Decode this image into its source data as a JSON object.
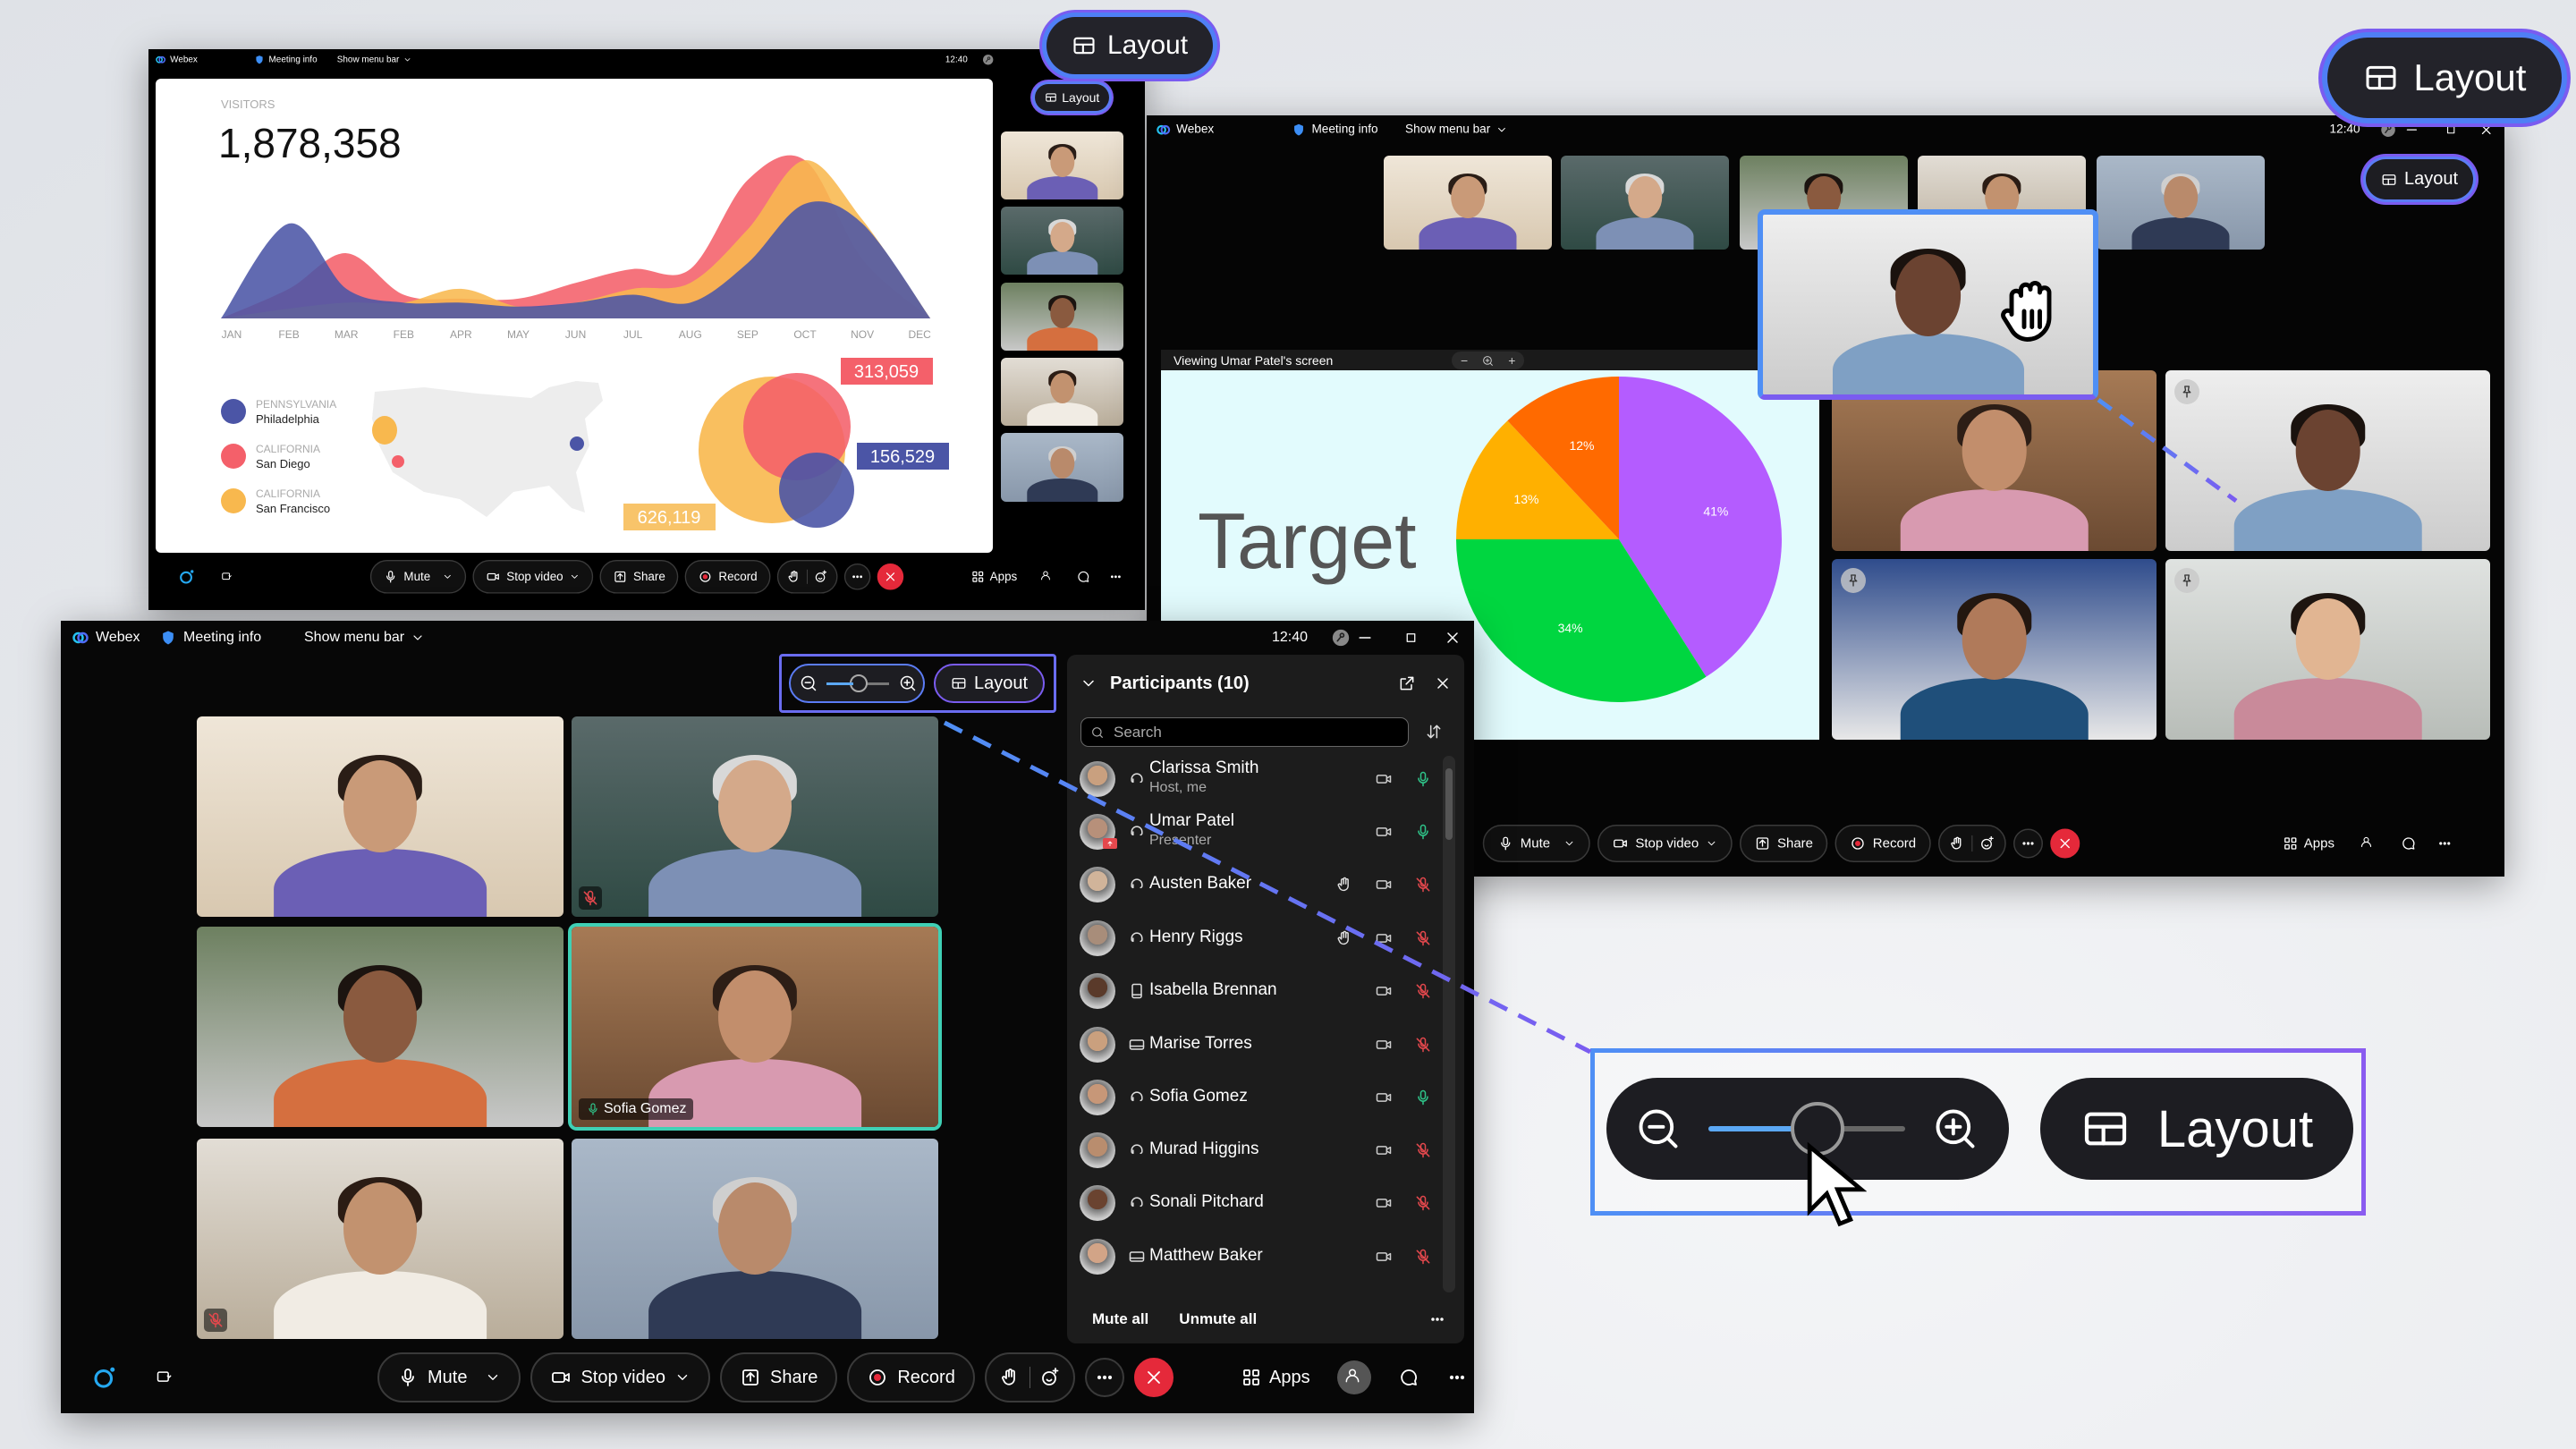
{
  "titlebar": {
    "app": "Webex",
    "meeting_info": "Meeting info",
    "show_menu_bar": "Show menu bar",
    "time": "12:40"
  },
  "toolbar": {
    "mute": "Mute",
    "stop_video": "Stop video",
    "share": "Share",
    "record": "Record",
    "apps": "Apps"
  },
  "layout_label": "Layout",
  "slide": {
    "visitors_label": "VISITORS",
    "visitors_value": "1,878,358",
    "legend": [
      {
        "state": "PENNSYLVANIA",
        "city": "Philadelphia",
        "color": "#4b55a6"
      },
      {
        "state": "CALIFORNIA",
        "city": "San Diego",
        "color": "#f4606a"
      },
      {
        "state": "CALIFORNIA",
        "city": "San Francisco",
        "color": "#f8b84e"
      }
    ],
    "bubble_labels": {
      "red": "313,059",
      "blue": "156,529",
      "yellow": "626,119"
    }
  },
  "chart_data": [
    {
      "type": "area",
      "categories": [
        "JAN",
        "FEB",
        "MAR",
        "FEB",
        "APR",
        "MAY",
        "JUN",
        "JUL",
        "AUG",
        "SEP",
        "OCT",
        "NOV",
        "DEC"
      ],
      "series": [
        {
          "color": "#f4606a",
          "values": [
            0,
            15,
            33,
            12,
            10,
            10,
            18,
            25,
            25,
            70,
            80,
            30,
            0
          ]
        },
        {
          "color": "#f8b84e",
          "values": [
            0,
            5,
            8,
            8,
            15,
            6,
            8,
            15,
            18,
            45,
            80,
            50,
            0
          ]
        },
        {
          "color": "#4b55a6",
          "values": [
            0,
            48,
            15,
            8,
            8,
            6,
            8,
            12,
            8,
            28,
            58,
            48,
            0
          ]
        }
      ],
      "grid": false
    },
    {
      "type": "pie",
      "title": "Target",
      "slices": [
        {
          "label": "41%",
          "value": 41,
          "color": "#b45cff"
        },
        {
          "label": "34%",
          "value": 34,
          "color": "#00d640"
        },
        {
          "label": "13%",
          "value": 13,
          "color": "#ffb000"
        },
        {
          "label": "12%",
          "value": 12,
          "color": "#ff6a00"
        }
      ]
    }
  ],
  "share_banner": "Viewing Umar Patel's screen",
  "tiles": {
    "sofia_label": "Sofia Gomez"
  },
  "participants": {
    "title": "Participants (10)",
    "search_placeholder": "Search",
    "mute_all": "Mute all",
    "unmute_all": "Unmute all",
    "list": [
      {
        "name": "Clarissa Smith",
        "sub": "Host, me",
        "device": "headset",
        "hand": false,
        "mic": "on"
      },
      {
        "name": "Umar Patel",
        "sub": "Presenter",
        "device": "headset",
        "hand": false,
        "mic": "on",
        "sharing": true
      },
      {
        "name": "Austen Baker",
        "sub": "",
        "device": "headset",
        "hand": true,
        "mic": "muted"
      },
      {
        "name": "Henry Riggs",
        "sub": "",
        "device": "headset",
        "hand": true,
        "mic": "muted"
      },
      {
        "name": "Isabella Brennan",
        "sub": "",
        "device": "tablet",
        "hand": false,
        "mic": "muted"
      },
      {
        "name": "Marise Torres",
        "sub": "",
        "device": "laptop",
        "hand": false,
        "mic": "muted"
      },
      {
        "name": "Sofia Gomez",
        "sub": "",
        "device": "headset",
        "hand": false,
        "mic": "on"
      },
      {
        "name": "Murad Higgins",
        "sub": "",
        "device": "headset",
        "hand": false,
        "mic": "muted"
      },
      {
        "name": "Sonali Pitchard",
        "sub": "",
        "device": "headset",
        "hand": false,
        "mic": "muted"
      },
      {
        "name": "Matthew Baker",
        "sub": "",
        "device": "laptop",
        "hand": false,
        "mic": "muted"
      }
    ]
  },
  "colors": {
    "accent_blue": "#5b7cf5",
    "accent_purple": "#7a5cf0",
    "end_call": "#e5293a",
    "mic_on": "#2fc58a",
    "mic_muted": "#e5484d",
    "active_speaker": "#3fd0b5"
  }
}
